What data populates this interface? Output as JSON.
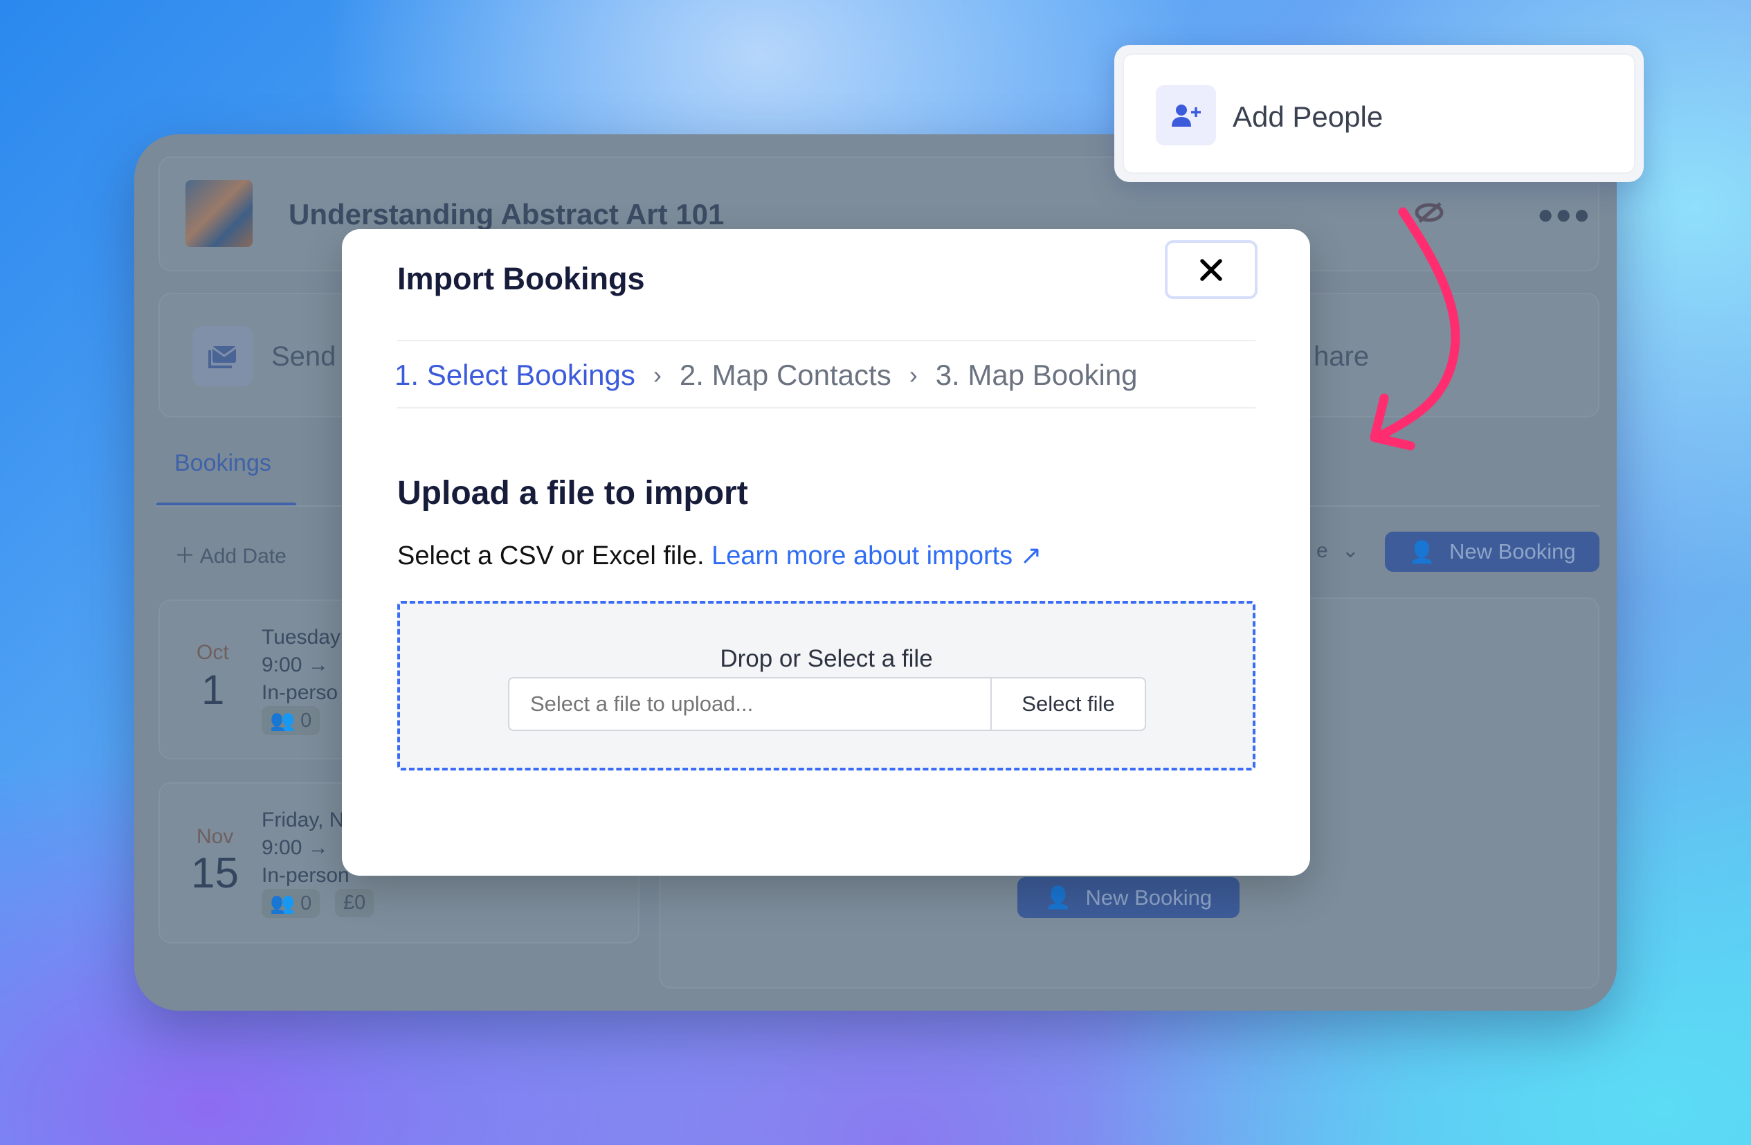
{
  "popover": {
    "label": "Add People",
    "icon": "user-plus-icon"
  },
  "app": {
    "title": "Understanding Abstract Art 101",
    "actions": {
      "send": "Send",
      "share": "hare"
    },
    "tabs": [
      {
        "label": "Bookings",
        "active": true
      }
    ],
    "add_date": "Add Date",
    "filter_partial": "e",
    "new_booking": "New Booking",
    "dates": [
      {
        "month": "Oct",
        "day": "1",
        "weekday": "Tuesday",
        "time": "9:00 →",
        "type": "In-perso",
        "people": "0"
      },
      {
        "month": "Nov",
        "day": "15",
        "weekday": "Friday, N",
        "time": "9:00 →",
        "type": "In-person",
        "people": "0",
        "price": "£0"
      }
    ]
  },
  "modal": {
    "title": "Import Bookings",
    "close_icon": "close-icon",
    "steps": [
      {
        "label": "1. Select Bookings",
        "active": true
      },
      {
        "label": "2. Map Contacts"
      },
      {
        "label": "3. Map Booking"
      }
    ],
    "step_separator": "›",
    "heading": "Upload a file to import",
    "description": "Select a CSV or Excel file.",
    "link": "Learn more about imports ↗",
    "dropzone": {
      "label": "Drop or Select a file",
      "placeholder": "Select a file to upload...",
      "button": "Select file"
    }
  },
  "colors": {
    "accent": "#3b5bdb",
    "link": "#2f6df5",
    "arrow": "#ff2d6f",
    "dropzone_border": "#3b6cf6"
  }
}
